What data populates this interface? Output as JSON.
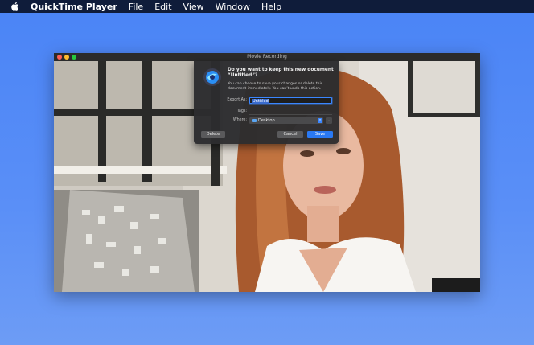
{
  "menubar": {
    "app_name": "QuickTime Player",
    "menus": [
      "File",
      "Edit",
      "View",
      "Window",
      "Help"
    ]
  },
  "window": {
    "title": "Movie Recording"
  },
  "dialog": {
    "heading": "Do you want to keep this new document “Untitled”?",
    "body": "You can choose to save your changes or delete this document immediately. You can’t undo this action.",
    "export_label": "Export As:",
    "export_value": "Untitled",
    "tags_label": "Tags:",
    "where_label": "Where:",
    "where_value": "Desktop",
    "delete_label": "Delete",
    "cancel_label": "Cancel",
    "save_label": "Save"
  },
  "colors": {
    "desktop": "#4a84f6",
    "menubar": "#0f1c3a",
    "accent": "#2a79f4"
  }
}
